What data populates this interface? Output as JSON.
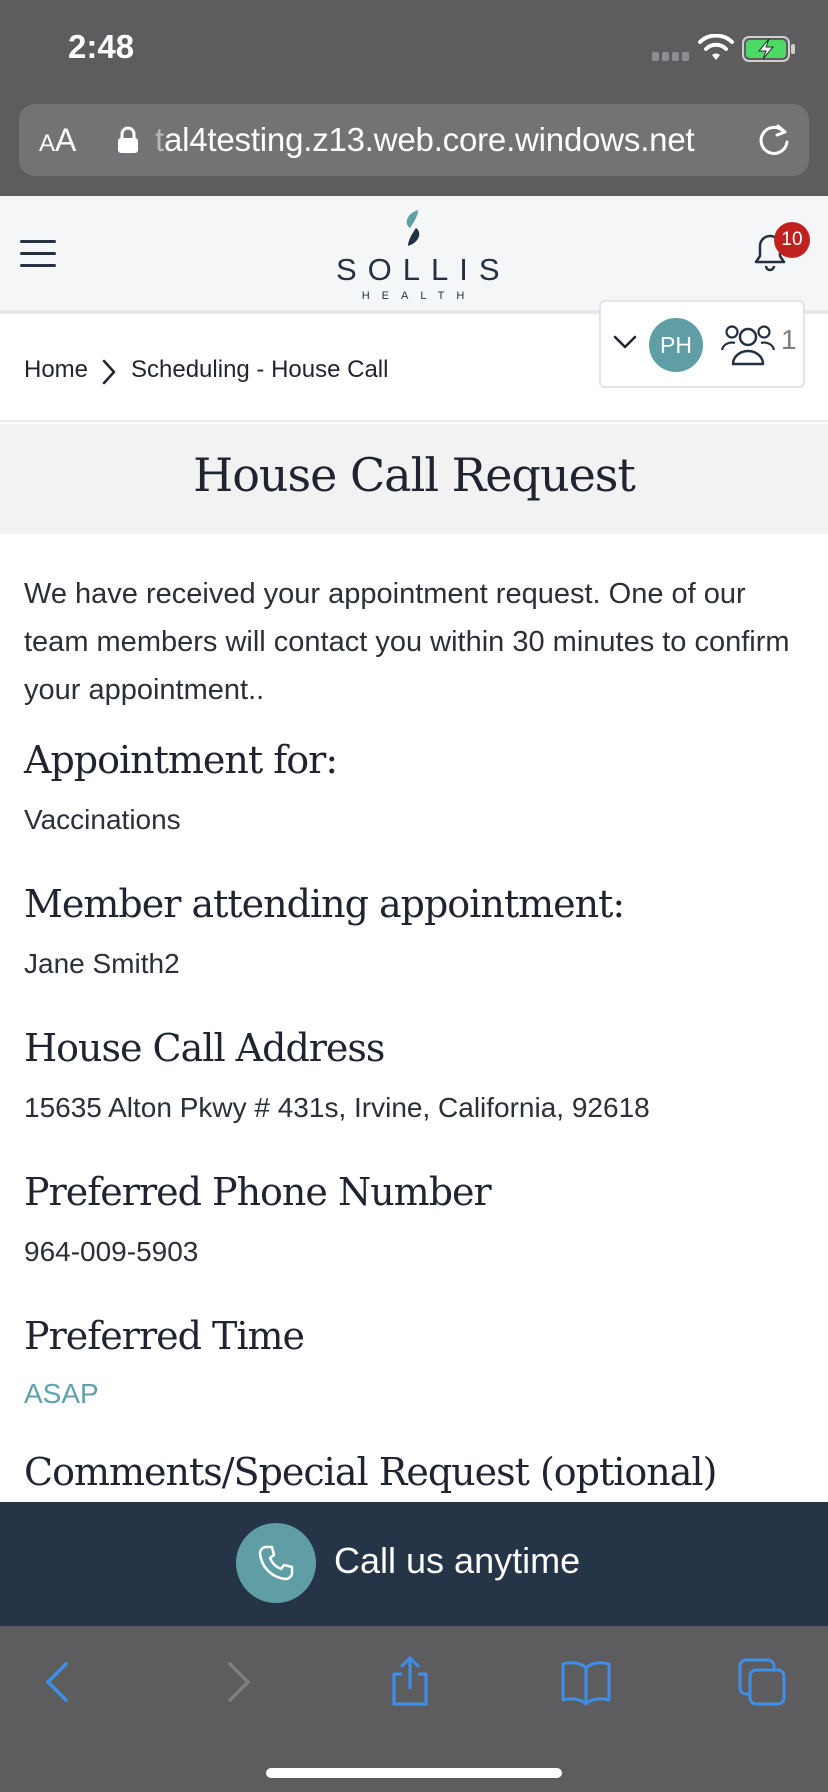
{
  "status_bar": {
    "time": "2:48"
  },
  "browser": {
    "text_size_small": "A",
    "text_size_big": "A",
    "url_faded": "t",
    "url": "al4testing.z13.web.core.windows.net"
  },
  "header": {
    "logo_word": "SOLLIS",
    "logo_sub": "HEALTH",
    "notification_count": "10"
  },
  "breadcrumb": {
    "home": "Home",
    "current": "Scheduling - House Call"
  },
  "member_switcher": {
    "avatar_initials": "PH",
    "member_count": "1"
  },
  "page": {
    "title": "House Call Request",
    "intro": "We have received your appointment request. One of our team members will contact you within 30 minutes to confirm your appointment.."
  },
  "sections": [
    {
      "heading": "Appointment for:",
      "value": "Vaccinations"
    },
    {
      "heading": "Member attending appointment:",
      "value": "Jane Smith2"
    },
    {
      "heading": "House Call Address",
      "value": "15635 Alton Pkwy # 431s, Irvine, California, 92618"
    },
    {
      "heading": "Preferred Phone Number",
      "value": "964-009-5903"
    },
    {
      "heading": "Preferred Time",
      "value": "ASAP"
    },
    {
      "heading": "Comments/Special Request (optional)"
    }
  ],
  "call_bar": {
    "label": "Call us anytime"
  },
  "colors": {
    "brand_navy": "#253446",
    "brand_teal": "#5f9ea5",
    "accent_link": "#5ea2ab",
    "badge_red": "#c0231f",
    "browser_chrome": "#5d5d60",
    "toolbar_blue": "#3d8fe8"
  },
  "icons": {
    "status": [
      "signal-icon",
      "wifi-icon",
      "battery-charging-icon"
    ],
    "browser": [
      "lock-icon",
      "reload-icon"
    ],
    "header": [
      "menu-icon",
      "bell-icon"
    ],
    "toolbar": [
      "back-icon",
      "forward-icon",
      "share-icon",
      "bookmarks-icon",
      "tabs-icon"
    ]
  }
}
